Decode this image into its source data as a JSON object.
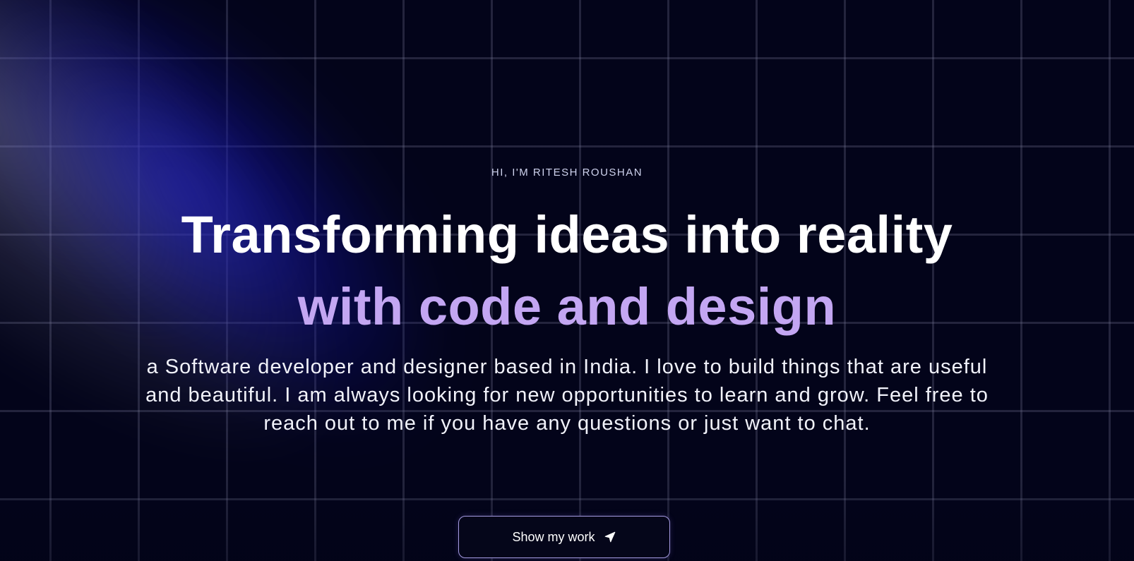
{
  "hero": {
    "eyebrow": "HI, I'M RITESH ROUSHAN",
    "headline_part1": "Transforming ideas into reality ",
    "headline_accent": "with code and design",
    "description": "a Software developer and designer based in India. I love to build things that are useful and beautiful. I am always looking for new opportunities to learn and grow. Feel free to reach out to me if you have any questions or just want to chat.",
    "cta_label": "Show my work",
    "cta_icon": "send-arrow-icon"
  },
  "colors": {
    "background": "#03041a",
    "accent_text": "#c3a6f2",
    "glow": "#1a1acc",
    "button_border": "#a49ae0"
  }
}
